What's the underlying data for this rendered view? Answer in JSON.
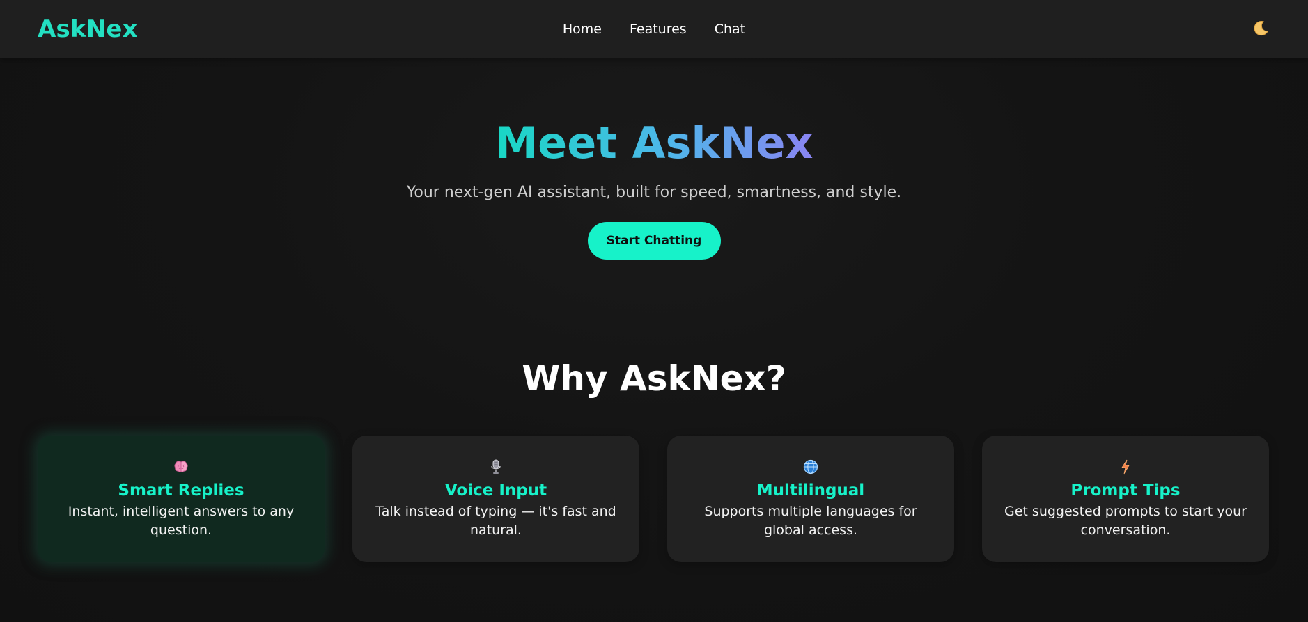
{
  "navbar": {
    "brand": "AskNex",
    "links": [
      {
        "label": "Home"
      },
      {
        "label": "Features"
      },
      {
        "label": "Chat"
      }
    ],
    "theme_toggle_icon": "moon-icon"
  },
  "hero": {
    "title": "Meet AskNex",
    "subtitle": "Your next-gen AI assistant, built for speed, smartness, and style.",
    "cta_label": "Start Chatting"
  },
  "features": {
    "title": "Why AskNex?",
    "cards": [
      {
        "icon": "brain-icon",
        "title": "Smart Replies",
        "desc": "Instant, intelligent answers to any question."
      },
      {
        "icon": "microphone-icon",
        "title": "Voice Input",
        "desc": "Talk instead of typing — it's fast and natural."
      },
      {
        "icon": "globe-icon",
        "title": "Multilingual",
        "desc": "Supports multiple languages for global access."
      },
      {
        "icon": "lightning-icon",
        "title": "Prompt Tips",
        "desc": "Get suggested prompts to start your conversation."
      }
    ]
  },
  "colors": {
    "accent": "#17f2c9",
    "brand": "#23e0c2",
    "background": "#121212",
    "card": "#222222",
    "card_active": "#10291f"
  }
}
